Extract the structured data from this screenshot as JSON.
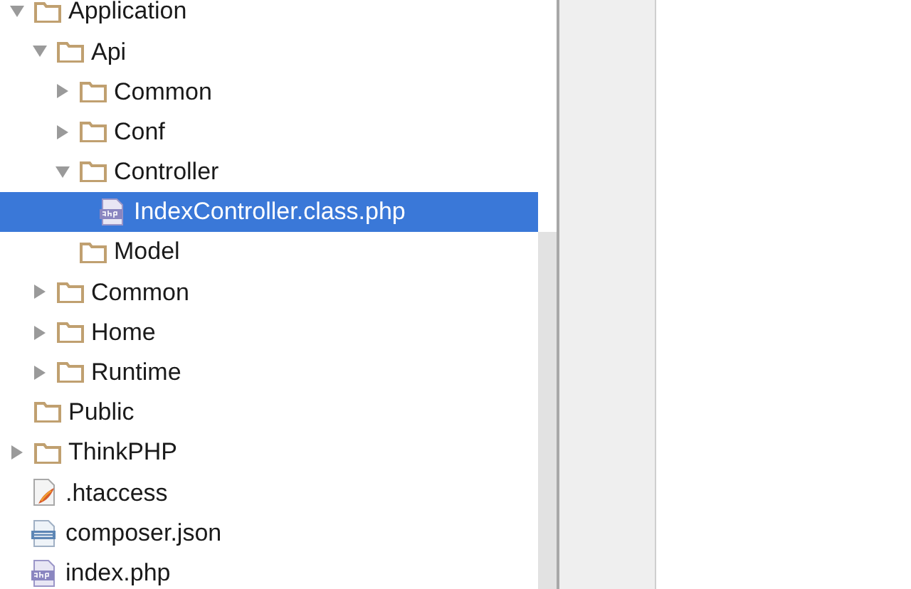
{
  "tree": [
    {
      "label": "Application",
      "kind": "folder",
      "expanded": true,
      "selected": false,
      "children": [
        {
          "label": "Api",
          "kind": "folder",
          "expanded": true,
          "selected": false,
          "children": [
            {
              "label": "Common",
              "kind": "folder",
              "expanded": false,
              "selected": false
            },
            {
              "label": "Conf",
              "kind": "folder",
              "expanded": false,
              "selected": false
            },
            {
              "label": "Controller",
              "kind": "folder",
              "expanded": true,
              "selected": false,
              "children": [
                {
                  "label": "IndexController.class.php",
                  "kind": "php",
                  "selected": true
                }
              ]
            },
            {
              "label": "Model",
              "kind": "folder",
              "selected": false
            }
          ]
        },
        {
          "label": "Common",
          "kind": "folder",
          "expanded": false,
          "selected": false
        },
        {
          "label": "Home",
          "kind": "folder",
          "expanded": false,
          "selected": false
        },
        {
          "label": "Runtime",
          "kind": "folder",
          "expanded": false,
          "selected": false
        }
      ]
    },
    {
      "label": "Public",
      "kind": "folder",
      "selected": false
    },
    {
      "label": "ThinkPHP",
      "kind": "folder",
      "expanded": false,
      "selected": false
    },
    {
      "label": ".htaccess",
      "kind": "htaccess",
      "selected": false
    },
    {
      "label": "composer.json",
      "kind": "json",
      "selected": false
    },
    {
      "label": "index.php",
      "kind": "php",
      "selected": false
    }
  ]
}
